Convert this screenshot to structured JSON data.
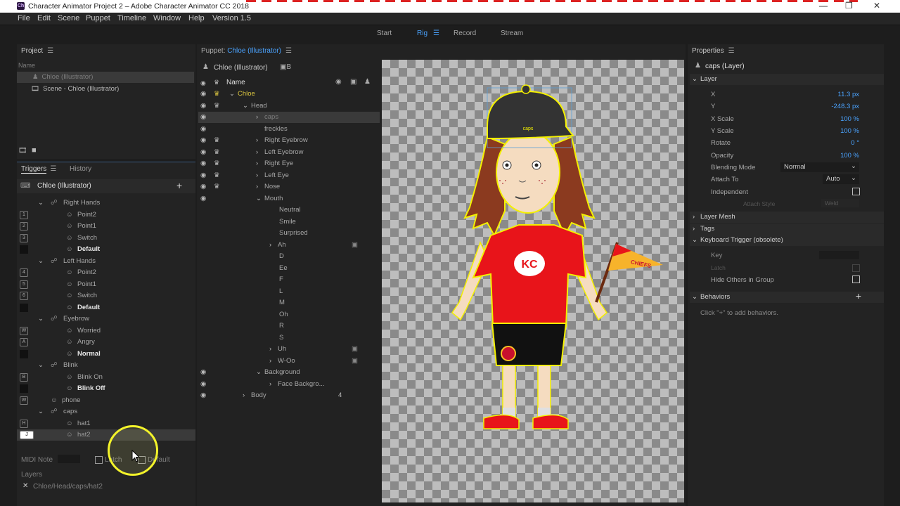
{
  "window": {
    "title": "Character Animator Project 2 – Adobe Character Animator CC 2018",
    "app_icon": "Ch"
  },
  "menu": [
    "File",
    "Edit",
    "Scene",
    "Puppet",
    "Timeline",
    "Window",
    "Help",
    "Version 1.5"
  ],
  "workspace": {
    "tabs": [
      "Start",
      "Rig",
      "Record",
      "Stream"
    ],
    "active": "Rig"
  },
  "project": {
    "title": "Project",
    "col": "Name",
    "items": [
      "Chloe (Illustrator)",
      "Scene - Chloe (Illustrator)"
    ]
  },
  "triggers": {
    "tabs": [
      "Triggers",
      "History"
    ],
    "puppet": "Chloe (Illustrator)",
    "rows": [
      {
        "label": "Right Hands",
        "group": true
      },
      {
        "label": "Point2",
        "key": "1"
      },
      {
        "label": "Point1",
        "key": "2"
      },
      {
        "label": "Switch",
        "key": "3"
      },
      {
        "label": "Default",
        "bold": true
      },
      {
        "label": "Left Hands",
        "group": true
      },
      {
        "label": "Point2",
        "key": "4"
      },
      {
        "label": "Point1",
        "key": "5"
      },
      {
        "label": "Switch",
        "key": "6"
      },
      {
        "label": "Default",
        "bold": true
      },
      {
        "label": "Eyebrow",
        "group": true
      },
      {
        "label": "Worried",
        "key": "W"
      },
      {
        "label": "Angry",
        "key": "A"
      },
      {
        "label": "Normal",
        "bold": true
      },
      {
        "label": "Blink",
        "group": true
      },
      {
        "label": "Blink On",
        "key": "B"
      },
      {
        "label": "Blink Off",
        "bold": true
      },
      {
        "label": "phone",
        "key": "W",
        "single": true
      },
      {
        "label": "caps",
        "group": true
      },
      {
        "label": "hat1",
        "key": "H"
      },
      {
        "label": "hat2",
        "key": "J",
        "selected": true
      }
    ],
    "midi_label": "MIDI Note",
    "latch": "Latch",
    "default": "Default",
    "layers_label": "Layers",
    "layer_path": "Chloe/Head/caps/hat2"
  },
  "puppet": {
    "title_prefix": "Puppet:",
    "title_name": "Chloe (Illustrator)",
    "name": "Chloe (Illustrator)",
    "badge": "B",
    "col": "Name",
    "rows": [
      {
        "label": "Chloe",
        "indent": 0,
        "arrow": "down",
        "eye": true,
        "crown": true,
        "gold": true
      },
      {
        "label": "Head",
        "indent": 1,
        "arrow": "down",
        "eye": true,
        "crown": true
      },
      {
        "label": "caps",
        "indent": 2,
        "arrow": "right",
        "eye": true,
        "dim": true,
        "sel": true
      },
      {
        "label": "freckles",
        "indent": 2,
        "eye": true
      },
      {
        "label": "Right Eyebrow",
        "indent": 2,
        "arrow": "right",
        "eye": true,
        "crown": true
      },
      {
        "label": "Left Eyebrow",
        "indent": 2,
        "arrow": "right",
        "eye": true,
        "crown": true
      },
      {
        "label": "Right Eye",
        "indent": 2,
        "arrow": "right",
        "eye": true,
        "crown": true
      },
      {
        "label": "Left Eye",
        "indent": 2,
        "arrow": "right",
        "eye": true,
        "crown": true
      },
      {
        "label": "Nose",
        "indent": 2,
        "arrow": "right",
        "eye": true,
        "crown": true
      },
      {
        "label": "Mouth",
        "indent": 2,
        "arrow": "down",
        "eye": true
      },
      {
        "label": "Neutral",
        "indent": 3
      },
      {
        "label": "Smile",
        "indent": 3
      },
      {
        "label": "Surprised",
        "indent": 3
      },
      {
        "label": "Ah",
        "indent": 3,
        "arrow": "right",
        "rec": true
      },
      {
        "label": "D",
        "indent": 3
      },
      {
        "label": "Ee",
        "indent": 3
      },
      {
        "label": "F",
        "indent": 3
      },
      {
        "label": "L",
        "indent": 3
      },
      {
        "label": "M",
        "indent": 3
      },
      {
        "label": "Oh",
        "indent": 3
      },
      {
        "label": "R",
        "indent": 3
      },
      {
        "label": "S",
        "indent": 3
      },
      {
        "label": "Uh",
        "indent": 3,
        "arrow": "right",
        "rec": true
      },
      {
        "label": "W-Oo",
        "indent": 3,
        "arrow": "right",
        "rec": true
      },
      {
        "label": "Background",
        "indent": 2,
        "arrow": "down",
        "eye": true
      },
      {
        "label": "Face Backgro...",
        "indent": 3,
        "arrow": "right",
        "eye": true
      },
      {
        "label": "Body",
        "indent": 1,
        "arrow": "right",
        "eye": true,
        "count": "4"
      }
    ]
  },
  "canvas": {
    "cap_text": "caps",
    "shirt_logo": "KC",
    "flag_text": "CHIEFS"
  },
  "properties": {
    "title": "Properties",
    "layer": "caps (Layer)",
    "section_layer": "Layer",
    "x": {
      "label": "X",
      "value": "11.3 px"
    },
    "y": {
      "label": "Y",
      "value": "-248.3 px"
    },
    "xscale": {
      "label": "X Scale",
      "value": "100 %"
    },
    "yscale": {
      "label": "Y Scale",
      "value": "100 %"
    },
    "rotate": {
      "label": "Rotate",
      "value": "0 °"
    },
    "opacity": {
      "label": "Opacity",
      "value": "100 %"
    },
    "blending": {
      "label": "Blending Mode",
      "value": "Normal"
    },
    "attach": {
      "label": "Attach To",
      "value": "Auto"
    },
    "independent": "Independent",
    "attach_style": {
      "label": "Attach Style",
      "value": "Weld"
    },
    "sections": [
      "Layer Mesh",
      "Tags",
      "Keyboard Trigger (obsolete)"
    ],
    "key": "Key",
    "latch": "Latch",
    "hide_others": "Hide Others in Group",
    "behaviors": "Behaviors",
    "behaviors_hint": "Click \"+\" to add behaviors."
  }
}
